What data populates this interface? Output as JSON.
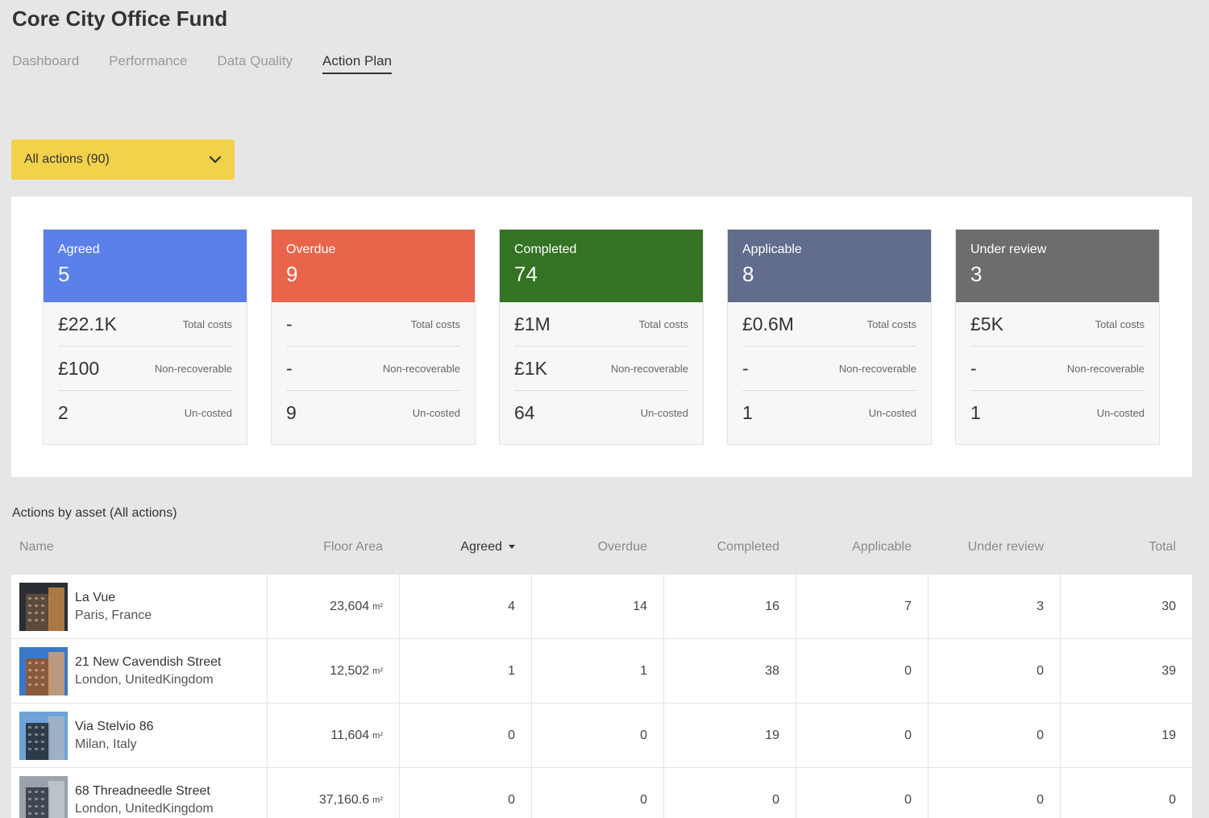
{
  "page": {
    "title": "Core City Office Fund"
  },
  "tabs": [
    {
      "label": "Dashboard",
      "active": false
    },
    {
      "label": "Performance",
      "active": false
    },
    {
      "label": "Data Quality",
      "active": false
    },
    {
      "label": "Action Plan",
      "active": true
    }
  ],
  "filter": {
    "label": "All actions (90)",
    "icon": "chevron-down-icon",
    "color": "#f2d24b"
  },
  "cards": [
    {
      "name": "Agreed",
      "count": "5",
      "color": "#5b80ea",
      "total_costs": "£22.1K",
      "non_recoverable": "£100",
      "un_costed": "2"
    },
    {
      "name": "Overdue",
      "count": "9",
      "color": "#e8644a",
      "total_costs": "-",
      "non_recoverable": "-",
      "un_costed": "9"
    },
    {
      "name": "Completed",
      "count": "74",
      "color": "#347224",
      "total_costs": "£1M",
      "non_recoverable": "£1K",
      "un_costed": "64"
    },
    {
      "name": "Applicable",
      "count": "8",
      "color": "#626c8c",
      "total_costs": "£0.6M",
      "non_recoverable": "-",
      "un_costed": "1"
    },
    {
      "name": "Under review",
      "count": "3",
      "color": "#6d6d6b",
      "total_costs": "£5K",
      "non_recoverable": "-",
      "un_costed": "1"
    }
  ],
  "card_labels": {
    "total_costs": "Total costs",
    "non_recoverable": "Non-recoverable",
    "un_costed": "Un-costed"
  },
  "table": {
    "title": "Actions by asset (All actions)",
    "headers": {
      "name": "Name",
      "floor_area": "Floor Area",
      "agreed": "Agreed",
      "overdue": "Overdue",
      "completed": "Completed",
      "applicable": "Applicable",
      "under_review": "Under review",
      "total": "Total"
    },
    "sorted_by": "agreed",
    "unit": "m²",
    "rows": [
      {
        "name": "La Vue",
        "location": "Paris, France",
        "floor_area": "23,604",
        "agreed": "4",
        "overdue": "14",
        "completed": "16",
        "applicable": "7",
        "under_review": "3",
        "total": "30",
        "thumb": "building-photo"
      },
      {
        "name": "21 New Cavendish Street",
        "location": "London, UnitedKingdom",
        "floor_area": "12,502",
        "agreed": "1",
        "overdue": "1",
        "completed": "38",
        "applicable": "0",
        "under_review": "0",
        "total": "39",
        "thumb": "building-photo"
      },
      {
        "name": "Via Stelvio 86",
        "location": "Milan, Italy",
        "floor_area": "11,604",
        "agreed": "0",
        "overdue": "0",
        "completed": "19",
        "applicable": "0",
        "under_review": "0",
        "total": "19",
        "thumb": "building-photo"
      },
      {
        "name": "68 Threadneedle Street",
        "location": "London, UnitedKingdom",
        "floor_area": "37,160.6",
        "agreed": "0",
        "overdue": "0",
        "completed": "0",
        "applicable": "0",
        "under_review": "0",
        "total": "0",
        "thumb": "building-photo"
      }
    ]
  }
}
